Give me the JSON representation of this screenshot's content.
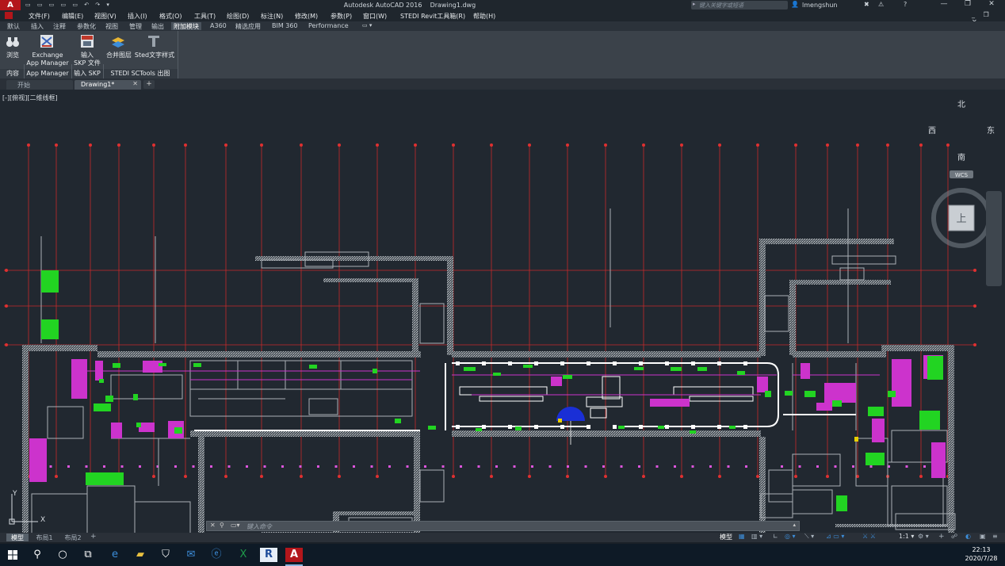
{
  "titlebar": {
    "title": "Autodesk AutoCAD 2016    Drawing1.dwg",
    "search_placeholder": "键入关键字或短语",
    "user": "lmengshun",
    "minimize": "—",
    "restore": "❐",
    "close": "✕"
  },
  "menubar": [
    "文件(F)",
    "编辑(E)",
    "视图(V)",
    "插入(I)",
    "格式(O)",
    "工具(T)",
    "绘图(D)",
    "标注(N)",
    "修改(M)",
    "参数(P)",
    "窗口(W)",
    "STEDI Revit工具箱(R)",
    "帮助(H)"
  ],
  "ribbon_tabs": [
    "默认",
    "插入",
    "注释",
    "参数化",
    "视图",
    "管理",
    "输出",
    "附加模块",
    "A360",
    "精选应用",
    "BIM 360",
    "Performance"
  ],
  "ribbon_active_tab": "附加模块",
  "ribbon_buttons": [
    {
      "line1": "浏览",
      "line2": ""
    },
    {
      "line1": "Exchange",
      "line2": "App Manager"
    },
    {
      "line1": "输入",
      "line2": "SKP 文件"
    },
    {
      "line1": "合并图层",
      "line2": ""
    },
    {
      "line1": "Sted文字样式",
      "line2": ""
    }
  ],
  "ribbon_panels": [
    "内容",
    "App Manager",
    "输入 SKP",
    "STEDI SCTools 出图"
  ],
  "doc_tabs": [
    "开始",
    "Drawing1*"
  ],
  "viewport_label": "[-][俯视][二维线框]",
  "viewcube": {
    "north": "北",
    "south": "南",
    "east": "东",
    "west": "西",
    "top": "上",
    "wcs": "WCS"
  },
  "ucs": {
    "x": "X",
    "y": "Y"
  },
  "command_placeholder": "键入命令",
  "layout_tabs": [
    "模型",
    "布局1",
    "布局2"
  ],
  "status": {
    "model": "模型",
    "scale": "1:1"
  },
  "clock": {
    "time": "22:13",
    "date": "2020/7/28"
  },
  "colors": {
    "accent": "#3c8dd9",
    "grid_red": "#e03030",
    "wall": "#9aa0a6",
    "green": "#22d422",
    "magenta": "#cc33cc",
    "white": "#ffffff",
    "blue": "#1a2fd6"
  }
}
